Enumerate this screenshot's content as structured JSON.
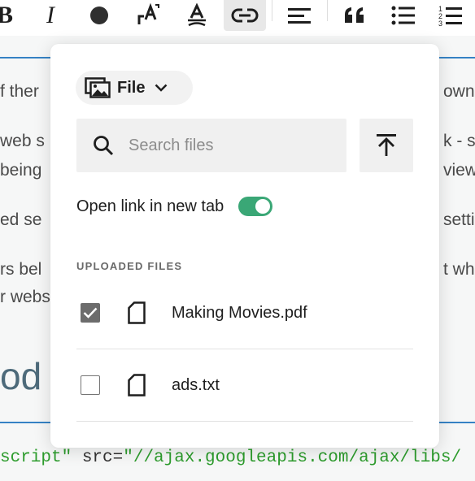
{
  "toolbar": {
    "bold_label": "B",
    "italic_label": "I",
    "buttons": [
      {
        "icon": "bold-icon"
      },
      {
        "icon": "italic-icon"
      },
      {
        "icon": "text-color-icon"
      },
      {
        "icon": "font-size-icon"
      },
      {
        "icon": "strikethrough-icon"
      },
      {
        "icon": "link-icon",
        "active": true
      },
      {
        "icon": "align-left-icon"
      },
      {
        "icon": "blockquote-icon"
      },
      {
        "icon": "bulleted-list-icon"
      },
      {
        "icon": "numbered-list-icon"
      }
    ]
  },
  "background": {
    "lines": [
      {
        "left": "f ther",
        "right": "own"
      },
      {
        "left": "web s",
        "right": "k - s"
      },
      {
        "left": "being",
        "right": "view"
      },
      {
        "left": "ed se",
        "right": "setti"
      },
      {
        "left": "rs bel",
        "right": "t wh"
      },
      {
        "left": "r webs",
        "right": ""
      }
    ],
    "heading_fragment": "od",
    "code": {
      "part1": "script\"",
      "part2": " src=",
      "part3": "\"//ajax.googleapis.com/ajax/libs/"
    }
  },
  "popover": {
    "link_type": {
      "label": "File",
      "icon": "image-gallery-icon"
    },
    "search": {
      "placeholder": "Search files",
      "value": ""
    },
    "upload_button": {
      "icon": "upload-icon"
    },
    "open_in_new_tab": {
      "label": "Open link in new tab",
      "enabled": true
    },
    "uploaded_files_heading": "UPLOADED FILES",
    "files": [
      {
        "name": "Making Movies.pdf",
        "checked": true
      },
      {
        "name": "ads.txt",
        "checked": false
      }
    ]
  },
  "colors": {
    "accent_blue": "#3582c4",
    "toggle_green": "#3aa776",
    "code_green": "#2d9c2d",
    "checkbox_checked": "#6c6c6c"
  }
}
